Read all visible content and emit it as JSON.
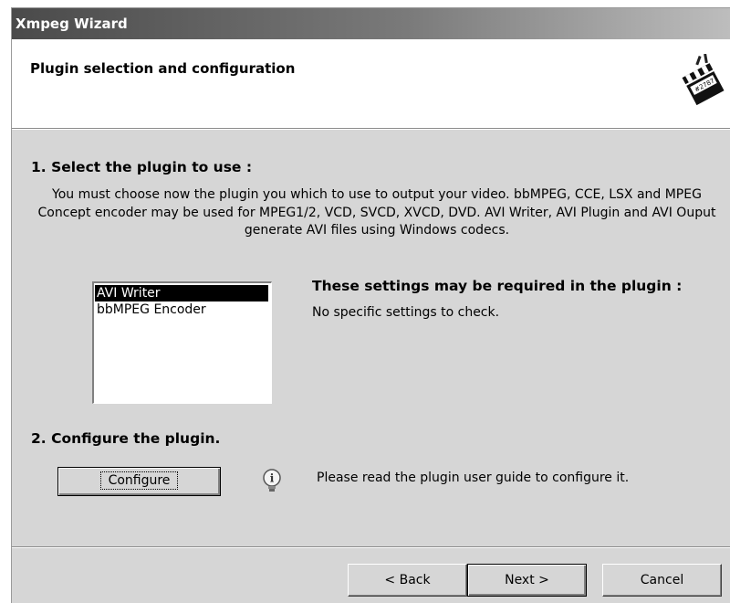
{
  "window": {
    "title": "Xmpeg Wizard"
  },
  "header": {
    "title": "Plugin selection and configuration",
    "icon": "clapperboard-icon"
  },
  "step1": {
    "title": "1. Select the plugin to use :",
    "description": "You must choose now the plugin you which to use to output your video. bbMPEG, CCE, LSX and MPEG Concept encoder may be used for MPEG1/2, VCD, SVCD, XVCD, DVD. AVI Writer, AVI Plugin and AVI Ouput generate AVI files using Windows codecs.",
    "plugins": [
      {
        "label": "AVI Writer",
        "selected": true
      },
      {
        "label": "bbMPEG Encoder",
        "selected": false
      }
    ],
    "settings_title": "These settings may be required in the plugin :",
    "settings_text": "No specific settings to check."
  },
  "step2": {
    "title": "2. Configure the plugin.",
    "configure_label": "Configure",
    "info_icon": "info-lightbulb-icon",
    "info_text": "Please read the plugin user guide to configure it."
  },
  "footer": {
    "back_label": "< Back",
    "next_label": "Next >",
    "cancel_label": "Cancel"
  },
  "colors": {
    "dialog_bg": "#d6d6d6",
    "selection_bg": "#000000",
    "titlebar_start": "#4a4a4a"
  }
}
